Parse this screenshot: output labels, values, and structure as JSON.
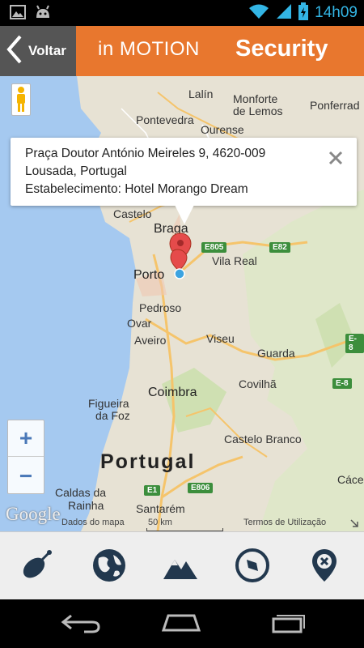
{
  "status": {
    "time": "14h09"
  },
  "header": {
    "back_label": "Voltar",
    "app_title": "in MOTION",
    "section_title": "Security"
  },
  "info_window": {
    "line1": "Praça Doutor António Meireles 9, 4620-009",
    "line2": "Lousada, Portugal",
    "line3": "Estabelecimento: Hotel Morango Dream"
  },
  "map": {
    "labels": {
      "lalin": "Lalín",
      "monforte": "Monforte",
      "de_lemos": "de Lemos",
      "ponferrada": "Ponferrad",
      "pontevedra": "Pontevedra",
      "ourense": "Ourense",
      "castelo": "Castelo",
      "braga": "Braga",
      "porto": "Porto",
      "vila_real": "Vila Real",
      "pedroso": "Pedroso",
      "ovar": "Ovar",
      "aveiro": "Aveiro",
      "viseu": "Viseu",
      "guarda": "Guarda",
      "covilha": "Covilhã",
      "figueira": "Figueira",
      "da_foz": "da Foz",
      "coimbra": "Coimbra",
      "castelo_branco": "Castelo Branco",
      "portugal": "Portugal",
      "caldas": "Caldas da",
      "rainha": "Rainha",
      "santarem": "Santarém",
      "caceres": "Cáce"
    },
    "roads": {
      "e805": "E805",
      "e82": "E82",
      "e8a": "E-8",
      "e8b": "E-8",
      "e1": "E1",
      "e806": "E806"
    },
    "zoom_in": "+",
    "zoom_out": "−",
    "logo": "Google",
    "attribution": "Dados do mapa",
    "scale": "50 km",
    "terms": "Termos de Utilização"
  },
  "colors": {
    "header": "#e8772e",
    "back": "#555555",
    "accent": "#33b5e5"
  }
}
